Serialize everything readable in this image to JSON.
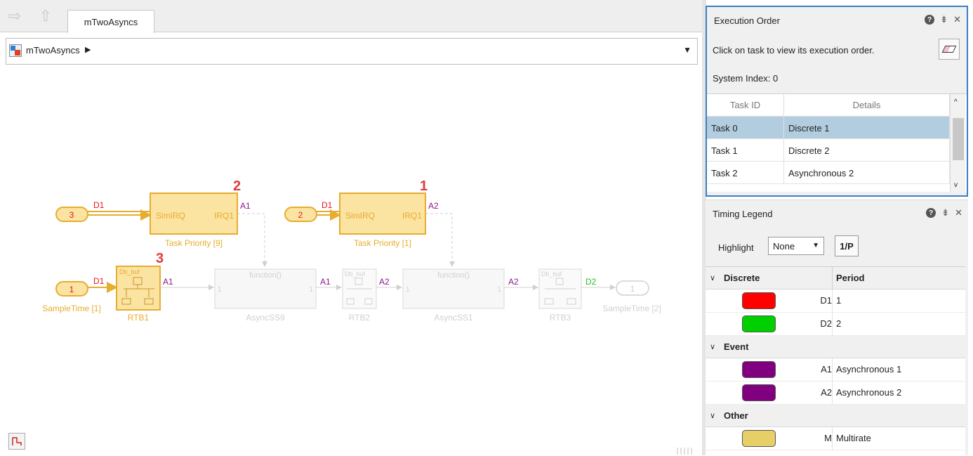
{
  "editor": {
    "tab_label": "mTwoAsyncs",
    "address_label": "mTwoAsyncs"
  },
  "diagram": {
    "inports": [
      {
        "number": "3",
        "rate": "D1"
      },
      {
        "number": "2",
        "rate": "D1"
      },
      {
        "number": "1",
        "rate": "D1",
        "caption": "SampleTime [1]"
      }
    ],
    "task_blocks": [
      {
        "port_in": "SimIRQ",
        "port_out": "IRQ1",
        "caption": "Task Priority [9]",
        "out_rate": "A1",
        "order": "2"
      },
      {
        "port_in": "SimIRQ",
        "port_out": "IRQ1",
        "caption": "Task Priority [1]",
        "out_rate": "A2",
        "order": "1"
      }
    ],
    "rtb1": {
      "top_label": "Db_buf",
      "caption": "RTB1",
      "out_rate": "A1",
      "order": "3"
    },
    "asyncss9": {
      "header": "function()",
      "in_port": "1",
      "out_port": "1",
      "caption": "AsyncSS9",
      "out_rate": "A1"
    },
    "rtb2": {
      "top_label": "Db_buf",
      "caption": "RTB2",
      "out_rate": "A2"
    },
    "asyncss1": {
      "header": "function()",
      "in_port": "1",
      "out_port": "1",
      "caption": "AsyncSS1",
      "out_rate": "A2"
    },
    "rtb3": {
      "top_label": "Db_buf",
      "caption": "RTB3",
      "out_rate": "D2"
    },
    "outport": {
      "number": "1",
      "caption": "SampleTime [2]"
    }
  },
  "execution_order": {
    "title": "Execution Order",
    "hint": "Click on task to view its execution order.",
    "system_index": "System Index: 0",
    "columns": [
      "Task ID",
      "Details"
    ],
    "rows": [
      {
        "task": "Task 0",
        "details": "Discrete 1",
        "selected": true
      },
      {
        "task": "Task 1",
        "details": "Discrete 2",
        "selected": false
      },
      {
        "task": "Task 2",
        "details": "Asynchronous 2",
        "selected": false
      }
    ]
  },
  "timing_legend": {
    "title": "Timing Legend",
    "highlight_label": "Highlight",
    "highlight_value": "None",
    "period_button": "1/P",
    "groups": [
      {
        "name": "Discrete",
        "column_label": "Period",
        "items": [
          {
            "label": "D1",
            "value": "1",
            "color": "#ff0000"
          },
          {
            "label": "D2",
            "value": "2",
            "color": "#00d000"
          }
        ]
      },
      {
        "name": "Event",
        "items": [
          {
            "label": "A1",
            "value": "Asynchronous 1",
            "color": "#800080"
          },
          {
            "label": "A2",
            "value": "Asynchronous 2",
            "color": "#800080"
          }
        ]
      },
      {
        "name": "Other",
        "items": [
          {
            "label": "M",
            "value": "Multirate",
            "color": "#e6cf66"
          }
        ]
      }
    ]
  },
  "colors": {
    "d1": "#e8141e",
    "d2": "#22c022",
    "async": "#8a1a8a",
    "multirate_fill": "#fbe3a2",
    "multirate_stroke": "#e6ad2e",
    "order_number": "#e03a3a",
    "inactive": "#d6d6d6",
    "accent": "#3a7fc3"
  }
}
